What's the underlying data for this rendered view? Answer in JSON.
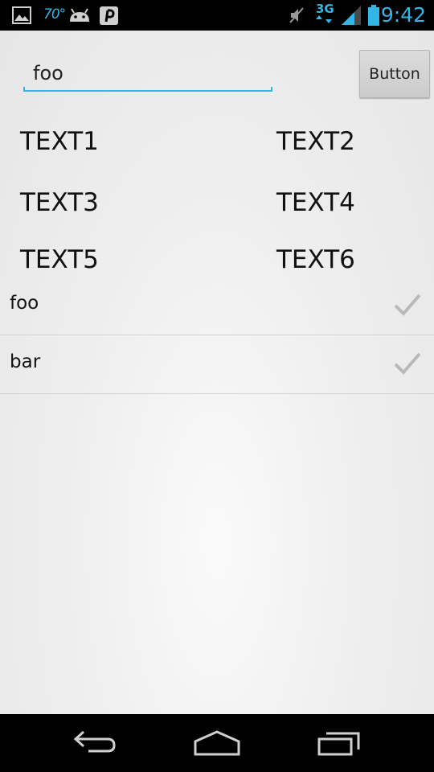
{
  "status_bar": {
    "temperature": "70°",
    "network": "3G",
    "time": "9:42",
    "icons": [
      "gallery-icon",
      "weather-icon",
      "android-icon",
      "pinterest-icon",
      "mute-icon",
      "network-3g-icon",
      "signal-icon",
      "battery-icon"
    ],
    "accent_color": "#33b5e5"
  },
  "form": {
    "input_value": "foo",
    "button_label": "Button"
  },
  "grid": {
    "items": [
      "TEXT1",
      "TEXT2",
      "TEXT3",
      "TEXT4",
      "TEXT5",
      "TEXT6"
    ]
  },
  "list": {
    "items": [
      {
        "label": "foo",
        "checked": true
      },
      {
        "label": "bar",
        "checked": true
      }
    ]
  },
  "nav_bar": {
    "icons": [
      "back-icon",
      "home-icon",
      "recent-apps-icon"
    ]
  }
}
